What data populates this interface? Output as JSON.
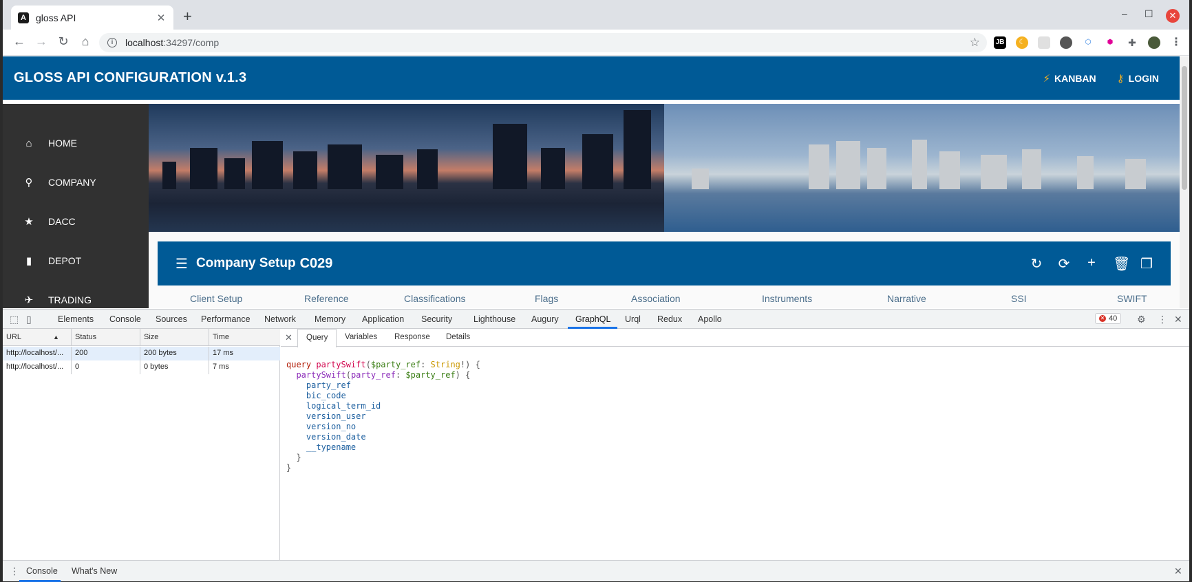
{
  "browser": {
    "tab_title": "gloss API",
    "tab_favicon": "A",
    "url_host": "localhost",
    "url_path": ":34297/comp",
    "extensions": [
      "JB",
      "moon-icon",
      "ext-icon",
      "circle-icon",
      "react-icon",
      "graphql-icon",
      "puzzle-icon",
      "avatar"
    ]
  },
  "app": {
    "title": "GLOSS API CONFIGURATION v.1.3",
    "actions": [
      {
        "label": "KANBAN",
        "icon": "bolt-icon"
      },
      {
        "label": "LOGIN",
        "icon": "key-icon"
      }
    ],
    "nav": [
      {
        "label": "HOME",
        "icon": "home-icon"
      },
      {
        "label": "COMPANY",
        "icon": "search-icon"
      },
      {
        "label": "DACC",
        "icon": "star-icon"
      },
      {
        "label": "DEPOT",
        "icon": "bookmark-icon"
      },
      {
        "label": "TRADING",
        "icon": "plane-icon"
      }
    ],
    "panel": {
      "title": "Company Setup",
      "code": "C029",
      "actions": [
        "refresh-icon",
        "sync-icon",
        "add-icon",
        "delete-icon",
        "copy-icon"
      ]
    },
    "subtabs": [
      "Client Setup",
      "Reference",
      "Classifications",
      "Flags",
      "Association",
      "Instruments",
      "Narrative",
      "SSI",
      "SWIFT"
    ]
  },
  "devtools": {
    "tabs": [
      "Elements",
      "Console",
      "Sources",
      "Performance",
      "Network",
      "Memory",
      "Application",
      "Security",
      "Lighthouse",
      "Augury",
      "GraphQL",
      "Urql",
      "Redux",
      "Apollo"
    ],
    "active_tab": "GraphQL",
    "error_count": "40",
    "network": {
      "columns": [
        "URL",
        "Status",
        "Size",
        "Time"
      ],
      "rows": [
        {
          "url": "http://localhost/...",
          "status": "200",
          "size": "200 bytes",
          "time": "17 ms"
        },
        {
          "url": "http://localhost/...",
          "status": "0",
          "size": "0 bytes",
          "time": "7 ms"
        }
      ]
    },
    "query_tabs": [
      "Query",
      "Variables",
      "Response",
      "Details"
    ],
    "active_query_tab": "Query",
    "query": {
      "op": "query",
      "name": "partySwift",
      "var": "$party_ref",
      "type": "String",
      "field": "partySwift",
      "arg": "party_ref",
      "fields": [
        "party_ref",
        "bic_code",
        "logical_term_id",
        "version_user",
        "version_no",
        "version_date",
        "__typename"
      ]
    },
    "drawer_tabs": [
      "Console",
      "What's New"
    ]
  }
}
